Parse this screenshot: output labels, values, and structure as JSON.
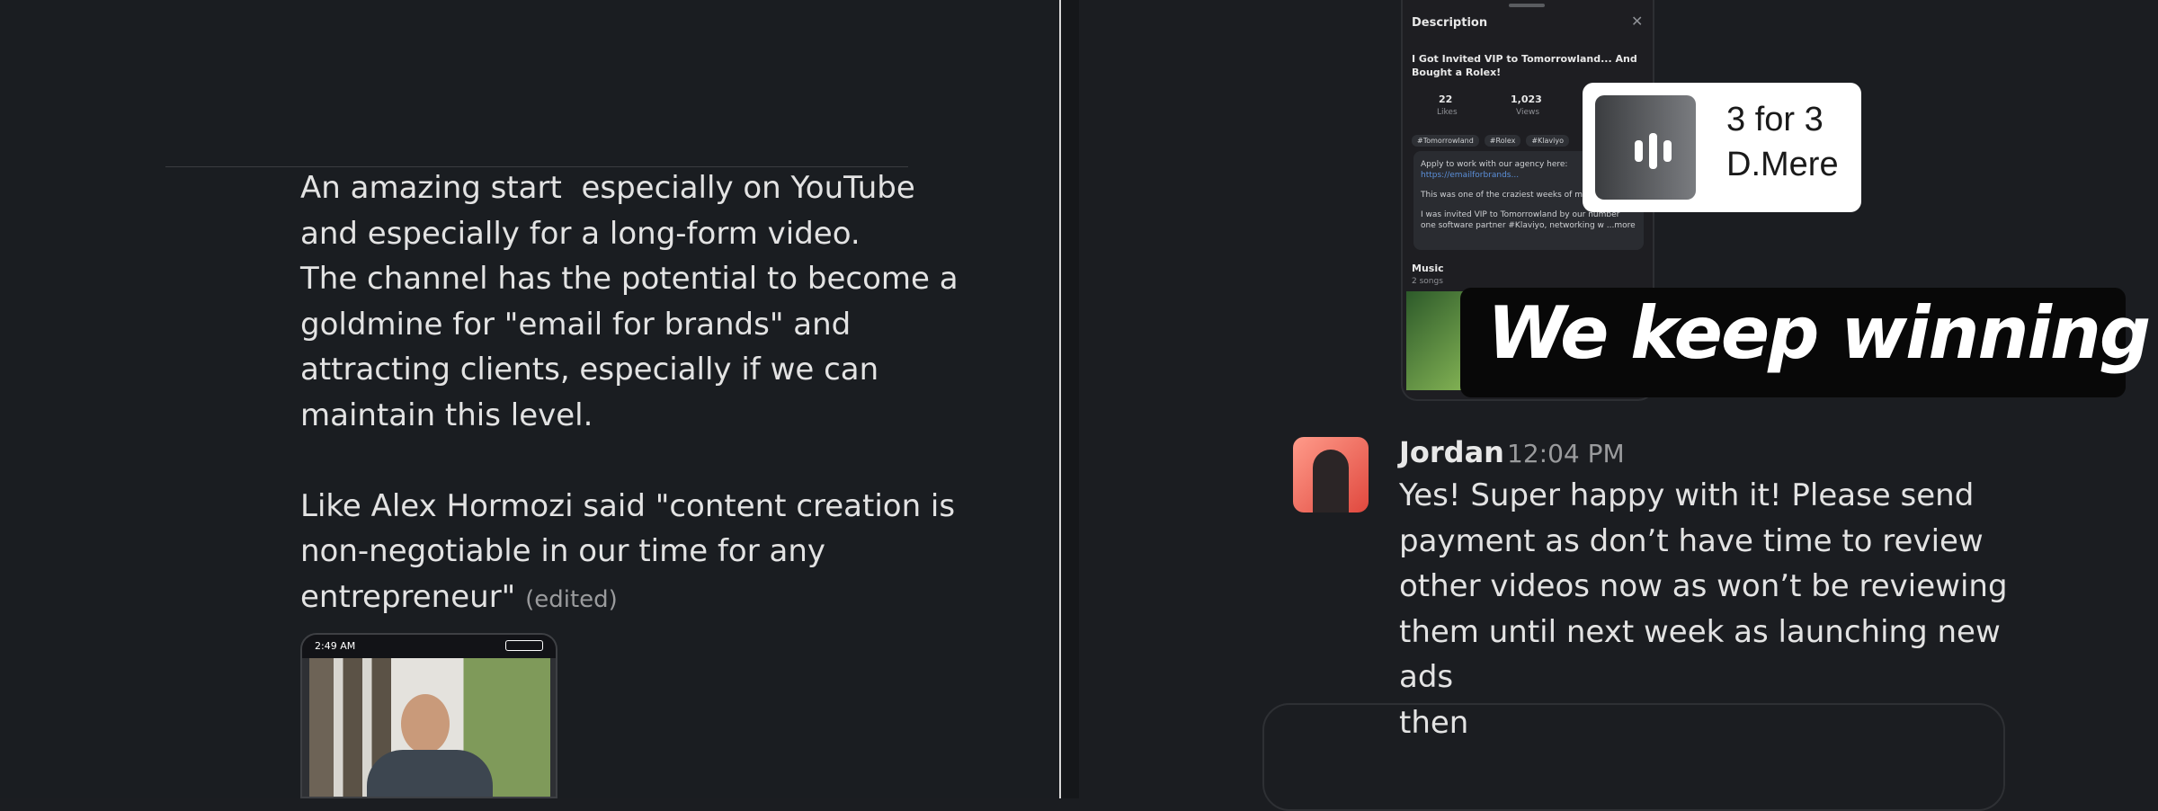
{
  "left_message": {
    "lines": [
      "An amazing start  especially on YouTube",
      "and especially for a long-form video.",
      "The channel has the potential to become a",
      "goldmine for \"email for brands\" and",
      "attracting clients, especially if we can",
      "maintain this level.",
      "",
      "Like Alex Hormozi said \"content creation is",
      "non-negotiable in our time for any"
    ],
    "last_line": "entrepreneur\"",
    "edited_label": "(edited)",
    "thumbnail_status_time": "2:49 AM"
  },
  "description_card": {
    "heading": "Description",
    "close_icon": "close-icon",
    "title": "I Got Invited VIP to Tomorrowland... And Bought a Rolex!",
    "stats": [
      {
        "value": "22",
        "label": "Likes"
      },
      {
        "value": "1,023",
        "label": "Views"
      }
    ],
    "tags": [
      "#Tomorrowland",
      "#Rolex",
      "#Klaviyo"
    ],
    "body_lines": [
      "Apply to work with our agency here:",
      "https://emailforbrands...",
      "This was one of the craziest weeks of m",
      "I was invited VIP to Tomorrowland by our number",
      "one software partner #Klaviyo, networking w ...more"
    ],
    "music_heading": "Music",
    "music_sub": "2 songs"
  },
  "popup": {
    "title": "3 for 3",
    "subtitle": "D.Mere",
    "icon": "audio-waveform-icon"
  },
  "banner": {
    "text": "We keep winning"
  },
  "reply": {
    "author": "Jordan",
    "time": "12:04 PM",
    "lines": [
      "Yes! Super happy with it! Please send",
      "payment as don’t have time to review",
      "other videos now as won’t be reviewing",
      "them until next week as launching new ads",
      "then"
    ]
  }
}
